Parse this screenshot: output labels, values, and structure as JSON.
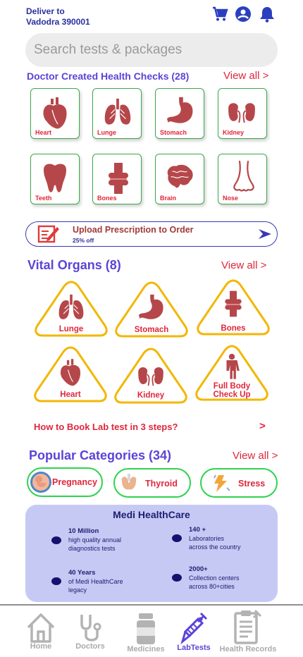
{
  "header": {
    "deliver_label": "Deliver to",
    "location": "Vadodra 390001",
    "icons": [
      "cart-icon",
      "account-icon",
      "bell-icon"
    ]
  },
  "search": {
    "placeholder": "Search tests & packages"
  },
  "health_checks": {
    "title": "Doctor Created Health Checks (28)",
    "view_all": "View all >",
    "items": [
      {
        "label": "Heart",
        "icon": "heart-icon"
      },
      {
        "label": "Lunge",
        "icon": "lungs-icon"
      },
      {
        "label": "Stomach",
        "icon": "stomach-icon"
      },
      {
        "label": "Kidney",
        "icon": "kidney-icon"
      },
      {
        "label": "Teeth",
        "icon": "tooth-icon"
      },
      {
        "label": "Bones",
        "icon": "bones-icon"
      },
      {
        "label": "Brain",
        "icon": "brain-icon"
      },
      {
        "label": "Nose",
        "icon": "nose-icon"
      }
    ]
  },
  "upload": {
    "title": "Upload Prescription to Order",
    "subtitle": "25% off"
  },
  "vital_organs": {
    "title": "Vital Organs (8)",
    "view_all": "View all >",
    "items": [
      {
        "label": "Lunge",
        "icon": "lungs-icon"
      },
      {
        "label": "Stomach",
        "icon": "stomach-icon"
      },
      {
        "label": "Bones",
        "icon": "bones-icon"
      },
      {
        "label": "Heart",
        "icon": "heart-icon"
      },
      {
        "label": "Kidney",
        "icon": "kidney-icon"
      },
      {
        "label": "Full Body",
        "label2": "Check Up",
        "icon": "body-icon"
      }
    ]
  },
  "how_to": {
    "text": "How to Book Lab test in 3 steps?",
    "arrow": ">"
  },
  "categories": {
    "title": "Popular Categories (34)",
    "view_all": "View all >",
    "items": [
      {
        "label": "Pregnancy",
        "icon": "pregnancy-icon"
      },
      {
        "label": "Thyroid",
        "icon": "thyroid-icon"
      },
      {
        "label": "Stress",
        "icon": "stress-icon"
      }
    ]
  },
  "medi": {
    "title": "Medi HealthCare",
    "stats": [
      {
        "value": "10 Million",
        "line1": "high quality annual",
        "line2": "diagnostics tests"
      },
      {
        "value": "140 +",
        "line1": "Laboratories",
        "line2": "across the country"
      },
      {
        "value": "40 Years",
        "line1": "of Medi HealthCare",
        "line2": "legacy"
      },
      {
        "value": "2000+",
        "line1": "Collection centers",
        "line2": "across 80+cities"
      }
    ]
  },
  "nav": {
    "items": [
      {
        "label": "Home",
        "icon": "home-icon"
      },
      {
        "label": "Doctors",
        "icon": "stethoscope-icon"
      },
      {
        "label": "Medicines",
        "icon": "pill-bottle-icon"
      },
      {
        "label": "LabTests",
        "icon": "syringe-icon",
        "active": true
      },
      {
        "label": "Health Records",
        "icon": "records-icon"
      }
    ]
  },
  "colors": {
    "accent_purple": "#5b44d6",
    "accent_red": "#e0263b",
    "organ_red": "#b5474a",
    "card_border_green": "#3aa84a",
    "triangle_gold": "#f2b705",
    "medi_bg": "#c7c9f5"
  }
}
